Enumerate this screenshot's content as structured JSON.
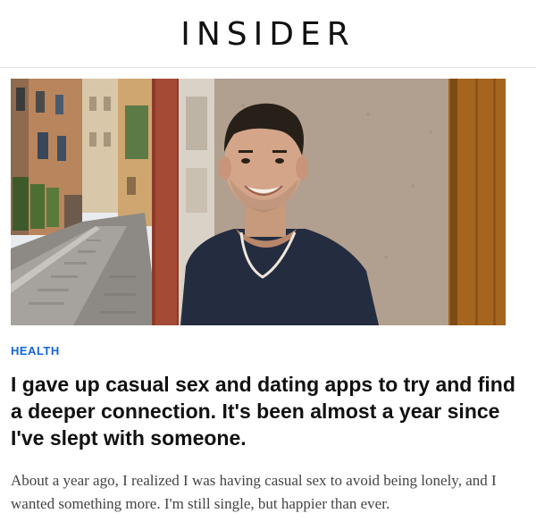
{
  "site": {
    "logo": "INSIDER"
  },
  "article": {
    "category": "HEALTH",
    "headline": "I gave up casual sex and dating apps to try and find a deeper connection. It's been almost a year since I've slept with someone.",
    "dek": "About a year ago, I realized I was having casual sex to avoid being lonely, and I wanted something more. I'm still single, but happier than ever."
  },
  "colors": {
    "category": "#1366d6",
    "headline": "#111111",
    "dek": "#444444",
    "divider": "#e3e3e3"
  }
}
